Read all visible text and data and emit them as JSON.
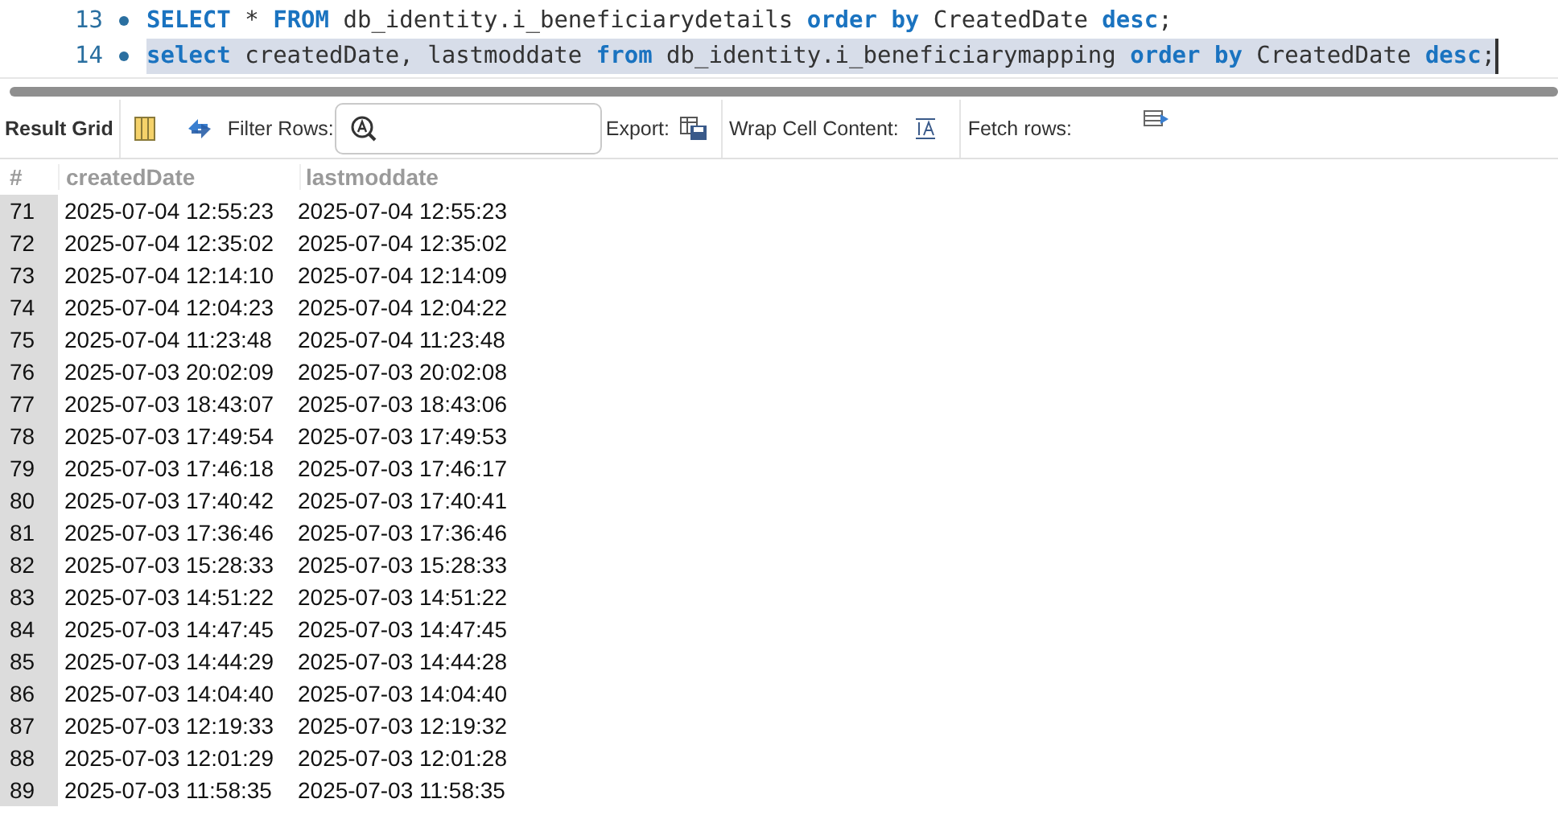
{
  "editor": {
    "lines": [
      {
        "number": "13",
        "selected": false,
        "tokens": [
          {
            "kind": "keyword",
            "text": "SELECT"
          },
          {
            "kind": "plain",
            "text": " * "
          },
          {
            "kind": "keyword",
            "text": "FROM"
          },
          {
            "kind": "plain",
            "text": " db_identity.i_beneficiarydetails "
          },
          {
            "kind": "keyword",
            "text": "order by"
          },
          {
            "kind": "plain",
            "text": " CreatedDate "
          },
          {
            "kind": "keyword",
            "text": "desc"
          },
          {
            "kind": "plain",
            "text": ";"
          }
        ]
      },
      {
        "number": "14",
        "selected": true,
        "tokens": [
          {
            "kind": "keyword",
            "text": "select"
          },
          {
            "kind": "plain",
            "text": " createdDate, lastmoddate "
          },
          {
            "kind": "keyword",
            "text": "from"
          },
          {
            "kind": "plain",
            "text": " db_identity.i_beneficiarymapping "
          },
          {
            "kind": "keyword",
            "text": "order by"
          },
          {
            "kind": "plain",
            "text": " CreatedDate "
          },
          {
            "kind": "keyword",
            "text": "desc"
          },
          {
            "kind": "plain",
            "text": ";"
          }
        ]
      }
    ]
  },
  "toolbar": {
    "result_grid": "Result Grid",
    "filter_rows": "Filter Rows:",
    "export": "Export:",
    "wrap_cell_content": "Wrap Cell Content:",
    "fetch_rows": "Fetch rows:"
  },
  "table": {
    "columns": [
      "#",
      "createdDate",
      "lastmoddate"
    ],
    "rows": [
      [
        "71",
        "2025-07-04 12:55:23",
        "2025-07-04 12:55:23"
      ],
      [
        "72",
        "2025-07-04 12:35:02",
        "2025-07-04 12:35:02"
      ],
      [
        "73",
        "2025-07-04 12:14:10",
        "2025-07-04 12:14:09"
      ],
      [
        "74",
        "2025-07-04 12:04:23",
        "2025-07-04 12:04:22"
      ],
      [
        "75",
        "2025-07-04 11:23:48",
        "2025-07-04 11:23:48"
      ],
      [
        "76",
        "2025-07-03 20:02:09",
        "2025-07-03 20:02:08"
      ],
      [
        "77",
        "2025-07-03 18:43:07",
        "2025-07-03 18:43:06"
      ],
      [
        "78",
        "2025-07-03 17:49:54",
        "2025-07-03 17:49:53"
      ],
      [
        "79",
        "2025-07-03 17:46:18",
        "2025-07-03 17:46:17"
      ],
      [
        "80",
        "2025-07-03 17:40:42",
        "2025-07-03 17:40:41"
      ],
      [
        "81",
        "2025-07-03 17:36:46",
        "2025-07-03 17:36:46"
      ],
      [
        "82",
        "2025-07-03 15:28:33",
        "2025-07-03 15:28:33"
      ],
      [
        "83",
        "2025-07-03 14:51:22",
        "2025-07-03 14:51:22"
      ],
      [
        "84",
        "2025-07-03 14:47:45",
        "2025-07-03 14:47:45"
      ],
      [
        "85",
        "2025-07-03 14:44:29",
        "2025-07-03 14:44:28"
      ],
      [
        "86",
        "2025-07-03 14:04:40",
        "2025-07-03 14:04:40"
      ],
      [
        "87",
        "2025-07-03 12:19:33",
        "2025-07-03 12:19:32"
      ],
      [
        "88",
        "2025-07-03 12:01:29",
        "2025-07-03 12:01:28"
      ],
      [
        "89",
        "2025-07-03 11:58:35",
        "2025-07-03 11:58:35"
      ]
    ]
  }
}
